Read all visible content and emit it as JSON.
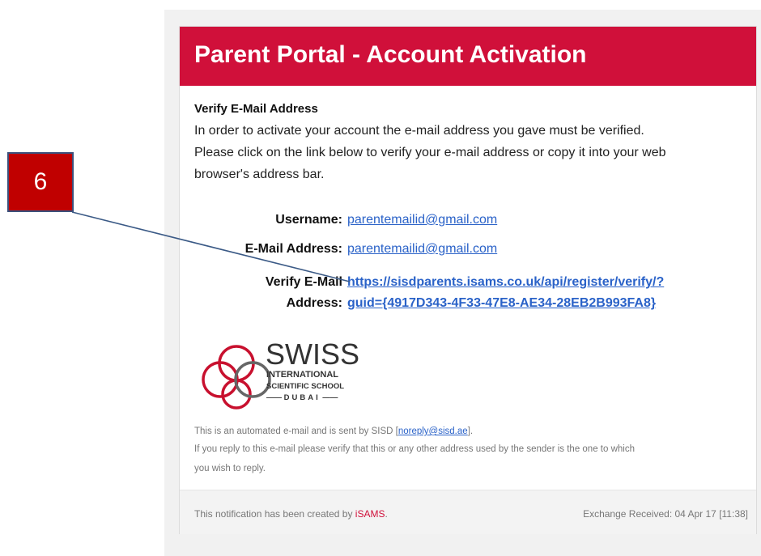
{
  "email": {
    "banner_title": "Parent Portal - Account Activation",
    "section_title": "Verify E-Mail Address",
    "intro_lines": [
      "In order to activate your account the e-mail address you gave must be verified.",
      "Please click on the link below to verify your e-mail address or copy it into your web",
      "browser's address bar."
    ],
    "fields": {
      "username_label": "Username:",
      "username_value": "parentemailid@gmail.com",
      "email_label": "E-Mail Address:",
      "email_value": "parentemailid@gmail.com",
      "verify_label_1": "Verify E-Mail",
      "verify_label_2": "Address:",
      "verify_link_1": "https://sisdparents.isams.co.uk/api/register/verify/?",
      "verify_link_2": "guid={4917D343-4F33-47E8-AE34-28EB2B993FA8}"
    },
    "logo": {
      "name_big": "SWISS",
      "name_line2": "INTERNATIONAL",
      "name_line3": "SCIENTIFIC SCHOOL",
      "name_line4": "DUBAI",
      "ring_color": "#c8102e"
    },
    "disclaimer": {
      "line1_prefix": "This is an automated e-mail and is sent by SISD [",
      "line1_link": "noreply@sisd.ae",
      "line1_suffix": "].",
      "line2": "If you reply to this e-mail please verify that this or any other address used by the sender is the one to which",
      "line3": "you wish to reply."
    },
    "footer": {
      "created_prefix": "This notification has been created by ",
      "created_brand": "iSAMS",
      "created_suffix": ".",
      "received": "Exchange Received: 04 Apr 17 [11:38]"
    }
  },
  "annotation": {
    "callout_number": "6",
    "callout_color": "#c00000"
  },
  "colors": {
    "banner": "#d0103a",
    "link": "#2a62c8"
  }
}
